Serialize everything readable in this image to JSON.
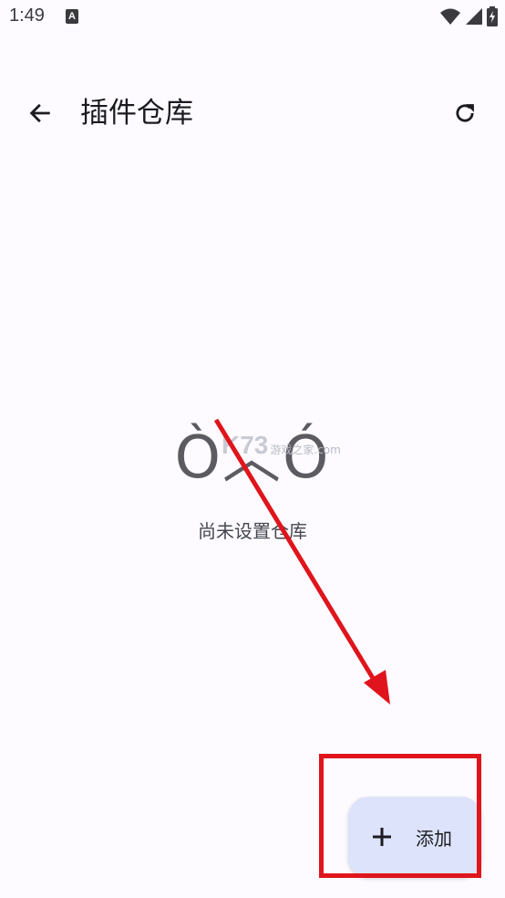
{
  "status_bar": {
    "time": "1:49",
    "notification_badge": "A",
    "icons": [
      "wifi-icon",
      "signal-icon",
      "battery-charging-icon"
    ]
  },
  "app_bar": {
    "back_icon": "arrow-left-icon",
    "title": "插件仓库",
    "refresh_icon": "refresh-icon"
  },
  "empty_state": {
    "face": "Ò︿Ó",
    "message": "尚未设置仓库"
  },
  "watermark": {
    "brand": "K73",
    "text": "游戏之家",
    "domain": ".com"
  },
  "fab": {
    "icon": "plus-icon",
    "label": "添加",
    "background": "#dde3fb"
  },
  "annotation": {
    "color": "#e0141c"
  }
}
